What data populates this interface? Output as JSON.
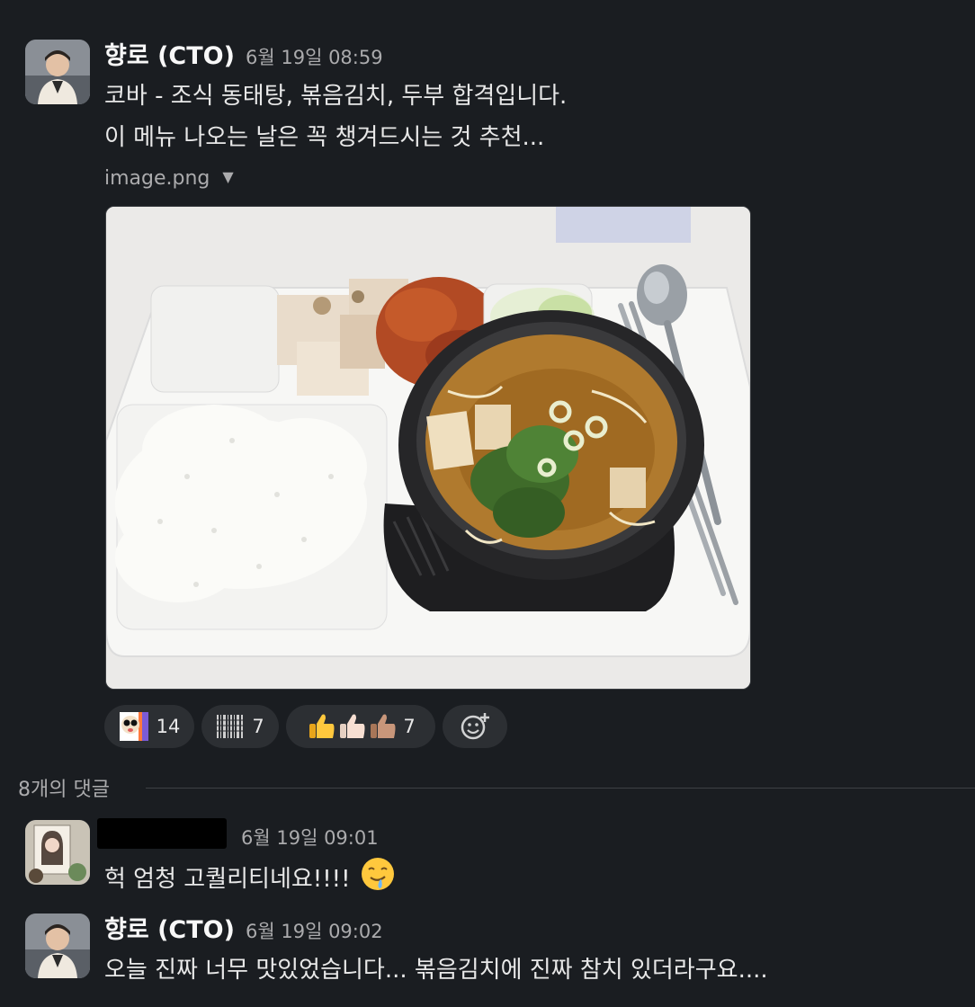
{
  "message1": {
    "author": "향로 (CTO)",
    "time": "6월 19일 08:59",
    "lines": [
      "코바 - 조식 동태탕, 볶음김치, 두부 합격입니다.",
      "이 메뉴 나오는 날은 꼭 챙겨드시는 것 추천..."
    ],
    "file_name": "image.png"
  },
  "reactions": [
    {
      "emoji": "kakao-face",
      "count": "14"
    },
    {
      "emoji": "barcode",
      "count": "7"
    },
    {
      "emoji": "thumbs-up-variants",
      "count": "7"
    },
    {
      "emoji": "add-reaction",
      "count": ""
    }
  ],
  "thread": {
    "label": "8개의 댓글"
  },
  "reply1": {
    "time": "6월 19일 09:01",
    "text": "헉 엄청 고퀄리티네요!!!!",
    "emoji": "drooling-face"
  },
  "reply2": {
    "author": "향로 (CTO)",
    "time": "6월 19일 09:02",
    "text": "오늘 진짜 너무 맛있었습니다... 볶음김치에 진짜 참치 있더라구요...."
  },
  "colors": {
    "background": "#1a1d21",
    "text": "#d1d2d3",
    "muted": "#ababad",
    "reaction_bg": "#2c2f33"
  }
}
